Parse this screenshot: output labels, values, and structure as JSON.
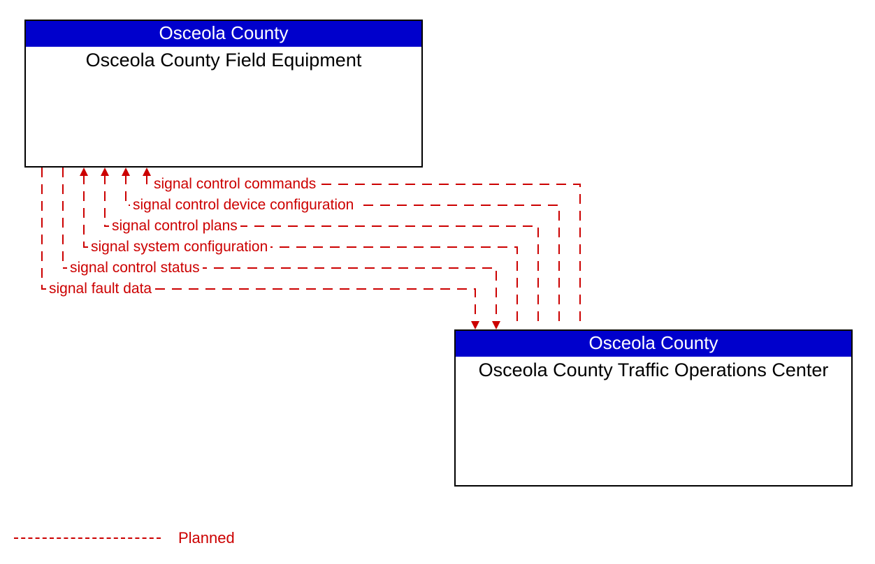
{
  "nodes": {
    "left": {
      "header": "Osceola County",
      "title": "Osceola County Field Equipment"
    },
    "right": {
      "header": "Osceola County",
      "title": "Osceola County Traffic Operations Center"
    }
  },
  "flows": {
    "f0": "signal control commands",
    "f1": "signal control device configuration",
    "f2": "signal control plans",
    "f3": "signal system configuration",
    "f4": "signal control status",
    "f5": "signal fault data"
  },
  "legend": {
    "planned": "Planned"
  },
  "colors": {
    "accent": "#cc0000",
    "header_bg": "#0000cc"
  }
}
